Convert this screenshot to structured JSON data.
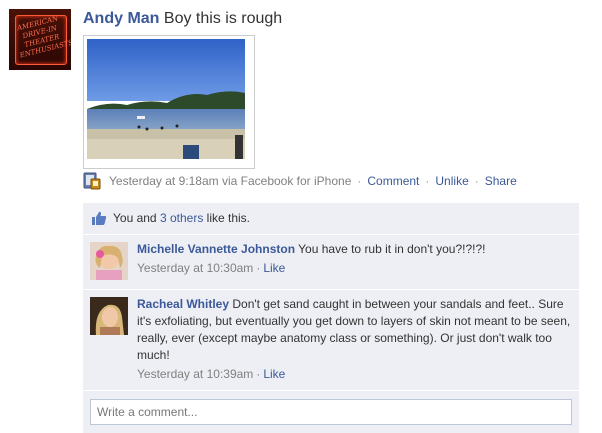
{
  "post": {
    "author": "Andy Man",
    "message": "Boy this is rough",
    "avatar_text": "AMERICAN DRIVE-IN THEATER ENTHUSIASTS",
    "timestamp": "Yesterday at 9:18am via Facebook for iPhone",
    "actions": {
      "comment": "Comment",
      "unlike": "Unlike",
      "share": "Share"
    }
  },
  "likes": {
    "prefix": "You and ",
    "others_link": "3 others",
    "suffix": " like this."
  },
  "comments": [
    {
      "name": "Michelle Vannette Johnston",
      "text": "You have to rub it in don't you?!?!?!",
      "time": "Yesterday at 10:30am",
      "like": "Like"
    },
    {
      "name": "Racheal Whitley",
      "text": "Don't get sand caught in between your sandals and feet.. Sure it's exfoliating, but eventually you get down to layers of skin not meant to be seen, really, ever (except maybe anatomy class or something). Or just don't walk too much!",
      "time": "Yesterday at 10:39am",
      "like": "Like"
    }
  ],
  "write_comment": {
    "placeholder": "Write a comment..."
  },
  "colors": {
    "link": "#3b5998",
    "feedback_bg": "#edeff4",
    "meta_text": "#808080"
  }
}
